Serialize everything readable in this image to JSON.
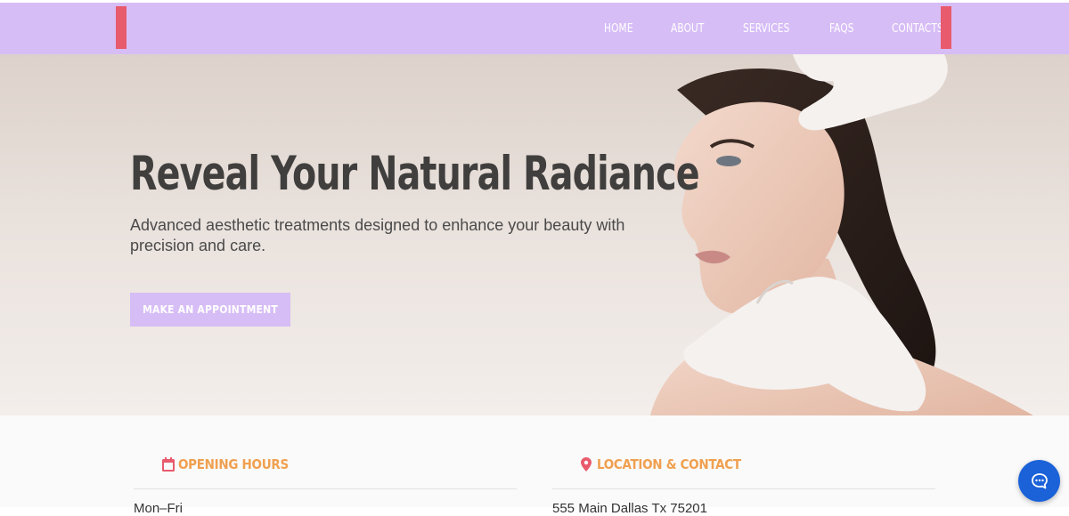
{
  "nav": {
    "links": [
      {
        "label": "HOME"
      },
      {
        "label": "ABOUT"
      },
      {
        "label": "SERVICES"
      },
      {
        "label": "FAQS"
      },
      {
        "label": "CONTACTS"
      }
    ]
  },
  "hero": {
    "title": "Reveal Your Natural Radiance",
    "subtitle": "Advanced aesthetic treatments designed to enhance your beauty with precision and care.",
    "cta_label": "MAKE AN APPOINTMENT"
  },
  "info": {
    "hours": {
      "icon": "calendar-icon",
      "heading": "OPENING HOURS",
      "first_line": "Mon–Fri"
    },
    "location": {
      "icon": "map-pin-icon",
      "heading": "LOCATION & CONTACT",
      "first_line": "555 Main Dallas Tx 75201"
    }
  },
  "chat": {
    "icon": "chat-bubble-icon"
  },
  "colors": {
    "nav_bg": "#d7bdf6",
    "nav_accent": "#e85b6d",
    "heading_accent": "#f0a050",
    "chat_button": "#1b62d9"
  }
}
